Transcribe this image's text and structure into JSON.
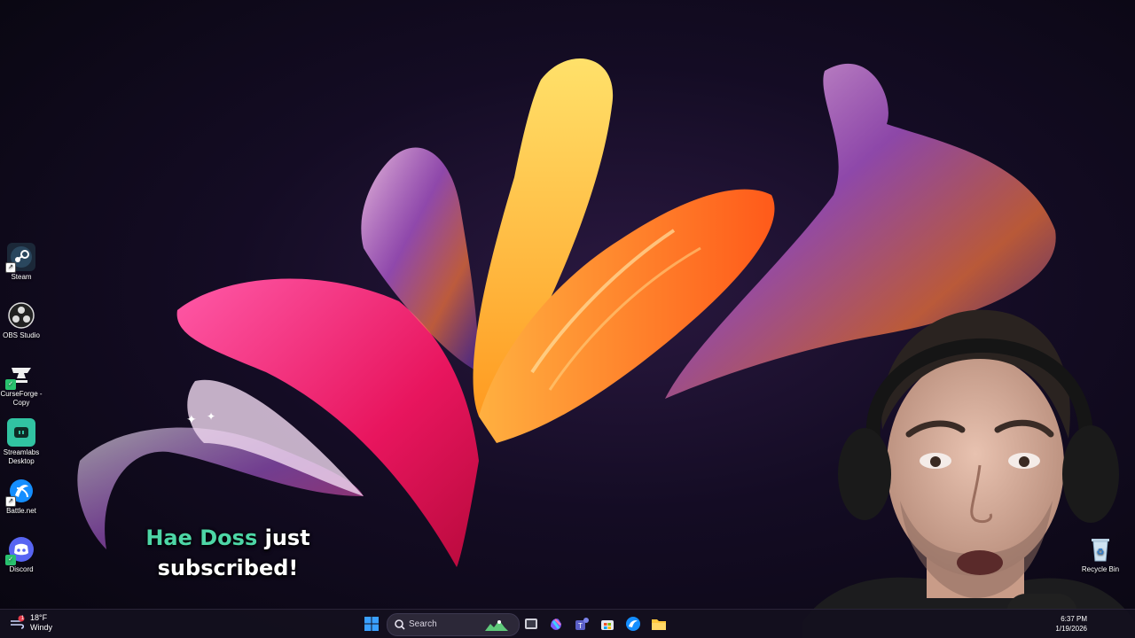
{
  "desktop": {
    "icons": [
      {
        "label": "Steam",
        "icon": "steam-icon"
      },
      {
        "label": "OBS Studio",
        "icon": "obs-icon"
      },
      {
        "label": "CurseForge - Copy",
        "icon": "curseforge-icon"
      },
      {
        "label": "Streamlabs Desktop",
        "icon": "streamlabs-icon"
      },
      {
        "label": "Battle.net",
        "icon": "battlenet-icon"
      },
      {
        "label": "Discord",
        "icon": "discord-icon"
      },
      {
        "label": "Recycle Bin",
        "icon": "recycle-bin-icon"
      }
    ]
  },
  "alert": {
    "name": "Hae Doss",
    "text_1": "just",
    "text_2": "subscribed!"
  },
  "taskbar": {
    "weather_temp": "18°F",
    "weather_desc": "Windy",
    "weather_badge": "1",
    "search_label": "Search",
    "time": "6:37 PM",
    "date": "1/19/2026",
    "colors": {
      "accent": "#4dd6a6",
      "start": "#3aa0ff"
    }
  }
}
